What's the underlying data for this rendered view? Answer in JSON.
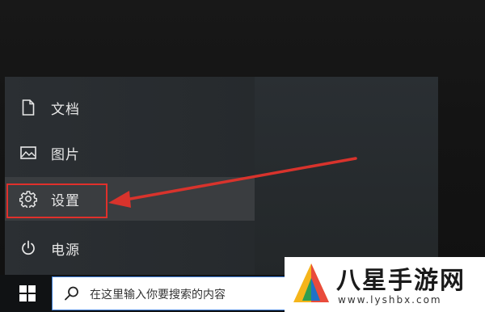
{
  "start_menu": {
    "items": [
      {
        "label": "文档",
        "icon": "document-icon"
      },
      {
        "label": "图片",
        "icon": "pictures-icon"
      },
      {
        "label": "设置",
        "icon": "gear-icon"
      },
      {
        "label": "电源",
        "icon": "power-icon"
      }
    ]
  },
  "taskbar": {
    "search_placeholder": "在这里输入你要搜索的内容"
  },
  "annotation": {
    "highlight_color": "#e0302b",
    "target": "设置"
  },
  "watermark": {
    "title": "八星手游网",
    "url": "www.lyshbx.com"
  }
}
